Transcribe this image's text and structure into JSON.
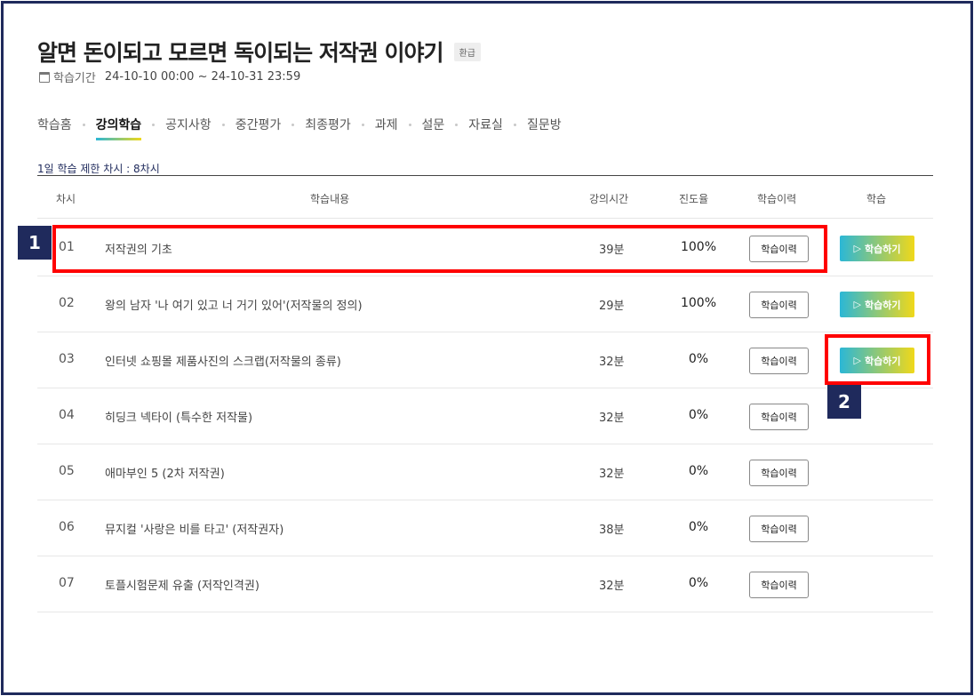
{
  "course": {
    "title": "알면 돈이되고 모르면 독이되는 저작권 이야기",
    "badge": "환급",
    "period_label": "학습기간",
    "period_value": "24-10-10 00:00 ~ 24-10-31 23:59"
  },
  "tabs": [
    {
      "label": "학습홈"
    },
    {
      "label": "강의학습",
      "active": true
    },
    {
      "label": "공지사항"
    },
    {
      "label": "중간평가"
    },
    {
      "label": "최종평가"
    },
    {
      "label": "과제"
    },
    {
      "label": "설문"
    },
    {
      "label": "자료실"
    },
    {
      "label": "질문방"
    }
  ],
  "daily_limit": "1일 학습 제한 차시 : 8차시",
  "table": {
    "headers": {
      "no": "차시",
      "content": "학습내용",
      "time": "강의시간",
      "progress": "진도율",
      "history": "학습이력",
      "study": "학습"
    },
    "rows": [
      {
        "no": "01",
        "title": "저작권의 기초",
        "time": "39분",
        "progress": "100%",
        "history_btn": "학습이력",
        "play_btn": "학습하기"
      },
      {
        "no": "02",
        "title": "왕의 남자 '나 여기 있고 너 거기 있어'(저작물의 정의)",
        "time": "29분",
        "progress": "100%",
        "history_btn": "학습이력",
        "play_btn": "학습하기"
      },
      {
        "no": "03",
        "title": "인터넷 쇼핑몰 제품사진의 스크랩(저작물의 종류)",
        "time": "32분",
        "progress": "0%",
        "history_btn": "학습이력",
        "play_btn": "학습하기"
      },
      {
        "no": "04",
        "title": "히딩크 넥타이 (특수한 저작물)",
        "time": "32분",
        "progress": "0%",
        "history_btn": "학습이력"
      },
      {
        "no": "05",
        "title": "애마부인 5 (2차 저작권)",
        "time": "32분",
        "progress": "0%",
        "history_btn": "학습이력"
      },
      {
        "no": "06",
        "title": "뮤지컬 '사랑은 비를 타고' (저작권자)",
        "time": "38분",
        "progress": "0%",
        "history_btn": "학습이력"
      },
      {
        "no": "07",
        "title": "토플시험문제 유출 (저작인격권)",
        "time": "32분",
        "progress": "0%",
        "history_btn": "학습이력"
      }
    ]
  },
  "annotations": {
    "marker_1": "1",
    "marker_2": "2"
  },
  "colors": {
    "frame": "#1f2a5c",
    "highlight": "#ff0000",
    "gradient_start": "#2bb7d6",
    "gradient_end": "#f0d81a"
  },
  "icons": {
    "period": "calendar-icon",
    "play": "play-icon"
  }
}
